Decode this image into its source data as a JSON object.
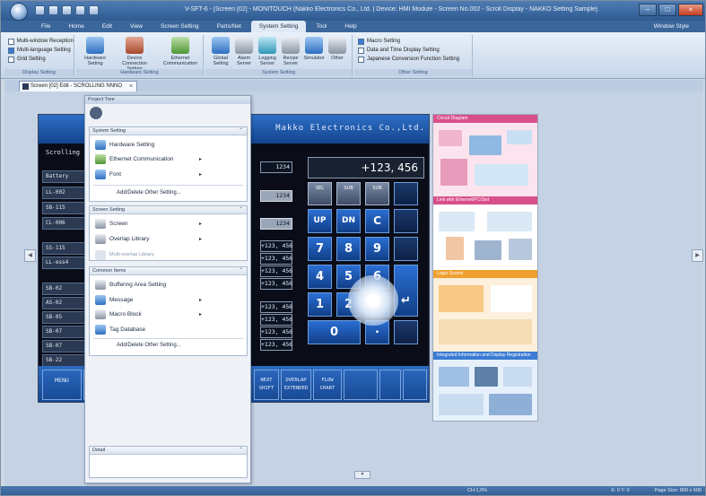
{
  "titlebar": {
    "title": "V-SFT-6 - [Screen [02] - MONITOUCH (Nakko Electronics Co., Ltd. | Device: HMI Module - Screen No.002 - Scroll Display - NAKKO Setting Sample]",
    "min_label": "–",
    "max_label": "□",
    "close_label": "×"
  },
  "ribbon": {
    "tabs": [
      "File",
      "Home",
      "Edit",
      "View",
      "Screen Setting",
      "Parts/Net",
      "System Setting",
      "Tool",
      "Help"
    ],
    "active_tab": "System Setting",
    "window_menu": "Window Style",
    "group1": {
      "checks": [
        "Multi-window Reception",
        "Multi-language Setting",
        "Grid Setting"
      ],
      "title": "Display Setting"
    },
    "group2": {
      "buttons": [
        "Hardware Setting",
        "Device Connection Setting",
        "Ethernet Communication"
      ],
      "title": "Hardware Setting"
    },
    "group3": {
      "buttons": [
        "Global Setting",
        "Alarm Server",
        "Logging Server",
        "Recipe Server",
        "Simulator",
        "Other"
      ],
      "title": "System Setting"
    },
    "group4": {
      "checks": [
        "Macro Setting",
        "Data and Time Display Setting",
        "Japanese Conversion Function Setting"
      ],
      "title": "Other Setting"
    }
  },
  "doc_tab": {
    "label": "Screen [02] Edit - SCROLLING NNNO",
    "close_label": "×"
  },
  "project_tree": {
    "title": "Project Tree",
    "system": {
      "title": "System Setting",
      "items": [
        "Hardware Setting",
        "Ethernet Communication",
        "Font"
      ],
      "add": "Add/Delete Other Setting..."
    },
    "screen": {
      "title": "Screen Setting",
      "items": [
        "Screen",
        "Overlap Library",
        "Multi-overlap Library"
      ]
    },
    "common": {
      "title": "Common Items",
      "items": [
        "Buffering Area Setting",
        "Message",
        "Macro Block",
        "Tag Database"
      ],
      "add": "Add/Delete Other Setting..."
    },
    "detail": {
      "title": "Detail"
    }
  },
  "hmi": {
    "company": "Makko Electronics Co.,Ltd.",
    "left_title": "Scrolling",
    "rows": [
      "Battery",
      "LL-002",
      "SB-115",
      "CL-006",
      "",
      "SS-115",
      "LL-ess4",
      "",
      "SB-02",
      "AS-02",
      "SB-05",
      "SB-07",
      "SB-07",
      "SB-22"
    ],
    "values": [
      "1234",
      "1234",
      "1234",
      "+123, 456",
      "+123, 456",
      "+123, 456",
      "+123, 456",
      "+123, 456",
      "+123, 456",
      "+123, 456",
      "+123, 456"
    ],
    "display": "+123, 456",
    "small_keys": [
      "SEL",
      "SUB",
      "SUB"
    ],
    "keys": [
      "UP",
      "DN",
      "C",
      "7",
      "8",
      "9",
      "4",
      "5",
      "6",
      "1",
      "2",
      "3",
      "↵",
      "0",
      "."
    ],
    "fn_buttons": [
      "MENU",
      "",
      "",
      "",
      "",
      "",
      "NEXT",
      "OVERLAP EXTENDED",
      "FLOW CHART",
      "",
      "",
      ""
    ],
    "fn_lines": [
      "SHIFT"
    ]
  },
  "preview": {
    "sections": [
      "Circuit Diagram",
      "Link with Ethernet/PC/Slot",
      "Login Screen",
      "Integrated Information and Display Registration"
    ]
  },
  "status": {
    "zoom": "CH:1,0%",
    "position": "X: 0  Y: 0",
    "right": "Page Size: 800 x 600"
  },
  "colors": {
    "title_bar": "#2d5a91",
    "hmi_blue": "#2b6fd3",
    "hmi_dark": "#0a0d18"
  }
}
